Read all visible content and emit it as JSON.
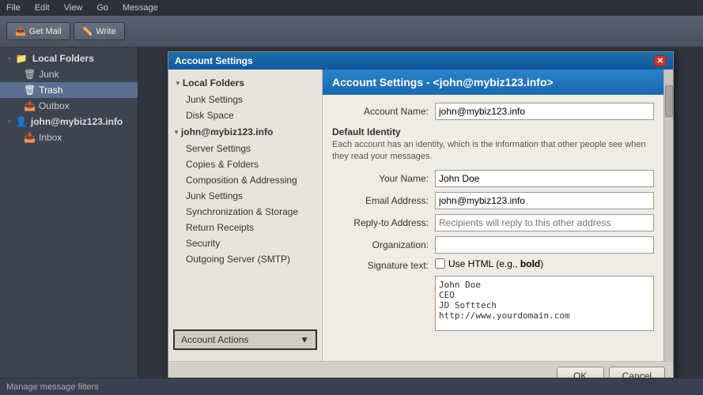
{
  "app": {
    "title": "Account Settings",
    "menubar": [
      "File",
      "Edit",
      "View",
      "Go",
      "Message"
    ]
  },
  "toolbar": {
    "get_mail_label": "Get Mail",
    "write_label": "Write"
  },
  "sidebar": {
    "items": [
      {
        "id": "local-folders",
        "label": "Local Folders",
        "type": "parent",
        "icon": "folder"
      },
      {
        "id": "junk",
        "label": "Junk",
        "indent": true,
        "icon": "folder"
      },
      {
        "id": "trash",
        "label": "Trash",
        "indent": true,
        "icon": "folder"
      },
      {
        "id": "outbox",
        "label": "Outbox",
        "indent": true,
        "icon": "folder"
      },
      {
        "id": "account",
        "label": "john@mybiz123.info",
        "type": "account",
        "icon": "account"
      },
      {
        "id": "inbox",
        "label": "Inbox",
        "indent": true,
        "icon": "folder"
      }
    ]
  },
  "dialog": {
    "title": "Account Settings",
    "header": "Account Settings - <john@mybiz123.info>",
    "close_btn": "✕",
    "left_panel": {
      "local_folders_label": "Local Folders",
      "junk_settings_label": "Junk Settings",
      "disk_space_label": "Disk Space",
      "account_label": "john@mybiz123.info",
      "server_settings_label": "Server Settings",
      "copies_folders_label": "Copies & Folders",
      "composition_label": "Composition & Addressing",
      "junk_label": "Junk Settings",
      "sync_label": "Synchronization & Storage",
      "return_receipts_label": "Return Receipts",
      "security_label": "Security",
      "outgoing_smtp_label": "Outgoing Server (SMTP)",
      "account_actions_label": "Account Actions",
      "account_actions_arrow": "▼"
    },
    "main": {
      "account_name_label": "Account Name:",
      "account_name_value": "john@mybiz123.info",
      "default_identity_title": "Default Identity",
      "default_identity_desc": "Each account has an identity, which is the information that other people see when they read your messages.",
      "your_name_label": "Your Name:",
      "your_name_value": "John Doe",
      "email_address_label": "Email Address:",
      "email_address_value": "john@mybiz123.info",
      "reply_to_label": "Reply-to Address:",
      "reply_to_placeholder": "Recipients will reply to this other address",
      "organization_label": "Organization:",
      "organization_value": "",
      "signature_label": "Signature text:",
      "use_html_label": "Use HTML (e.g., <b>bold</b>)",
      "signature_text": "John Doe\nCEO\nJD Softtech\nhttp://www.yourdomain.com"
    },
    "footer": {
      "ok_label": "OK",
      "cancel_label": "Cancel"
    }
  },
  "statusbar": {
    "text": "Manage message filters"
  }
}
